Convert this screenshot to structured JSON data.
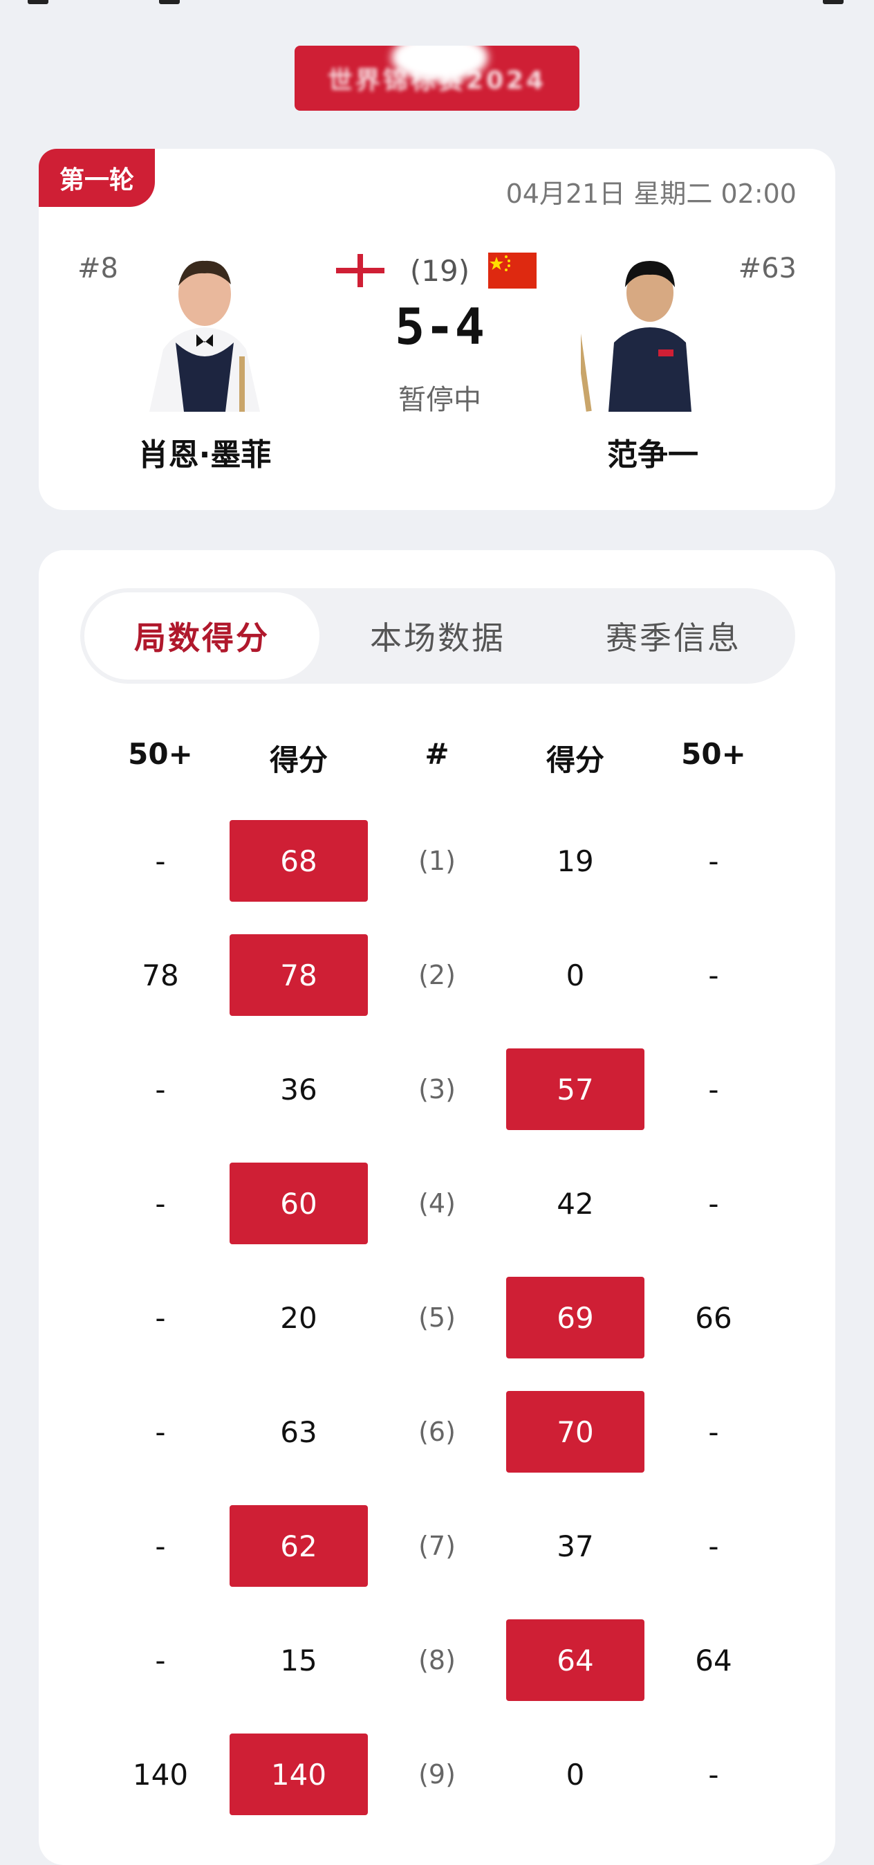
{
  "event_banner": "世界锦标赛2024",
  "match": {
    "round": "第一轮",
    "time": "04月21日 星期二 02:00",
    "best_of": "(19)",
    "score": "5-4",
    "status": "暂停中",
    "player1": {
      "name": "肖恩·墨菲",
      "rank": "#8",
      "flag": "england-flag-icon"
    },
    "player2": {
      "name": "范争一",
      "rank": "#63",
      "flag": "china-flag-icon"
    }
  },
  "tabs": [
    {
      "label": "局数得分",
      "active": true
    },
    {
      "label": "本场数据",
      "active": false
    },
    {
      "label": "赛季信息",
      "active": false
    }
  ],
  "table": {
    "headers": [
      "50+",
      "得分",
      "#",
      "得分",
      "50+"
    ],
    "rows": [
      {
        "p1_break": "-",
        "p1_score": "68",
        "frame": "(1)",
        "p2_score": "19",
        "p2_break": "-",
        "winner": 1
      },
      {
        "p1_break": "78",
        "p1_score": "78",
        "frame": "(2)",
        "p2_score": "0",
        "p2_break": "-",
        "winner": 1
      },
      {
        "p1_break": "-",
        "p1_score": "36",
        "frame": "(3)",
        "p2_score": "57",
        "p2_break": "-",
        "winner": 2
      },
      {
        "p1_break": "-",
        "p1_score": "60",
        "frame": "(4)",
        "p2_score": "42",
        "p2_break": "-",
        "winner": 1
      },
      {
        "p1_break": "-",
        "p1_score": "20",
        "frame": "(5)",
        "p2_score": "69",
        "p2_break": "66",
        "winner": 2
      },
      {
        "p1_break": "-",
        "p1_score": "63",
        "frame": "(6)",
        "p2_score": "70",
        "p2_break": "-",
        "winner": 2
      },
      {
        "p1_break": "-",
        "p1_score": "62",
        "frame": "(7)",
        "p2_score": "37",
        "p2_break": "-",
        "winner": 1
      },
      {
        "p1_break": "-",
        "p1_score": "15",
        "frame": "(8)",
        "p2_score": "64",
        "p2_break": "64",
        "winner": 2
      },
      {
        "p1_break": "140",
        "p1_score": "140",
        "frame": "(9)",
        "p2_score": "0",
        "p2_break": "-",
        "winner": 1
      }
    ]
  },
  "colors": {
    "accent": "#cf1f35",
    "background": "#eef0f4"
  }
}
